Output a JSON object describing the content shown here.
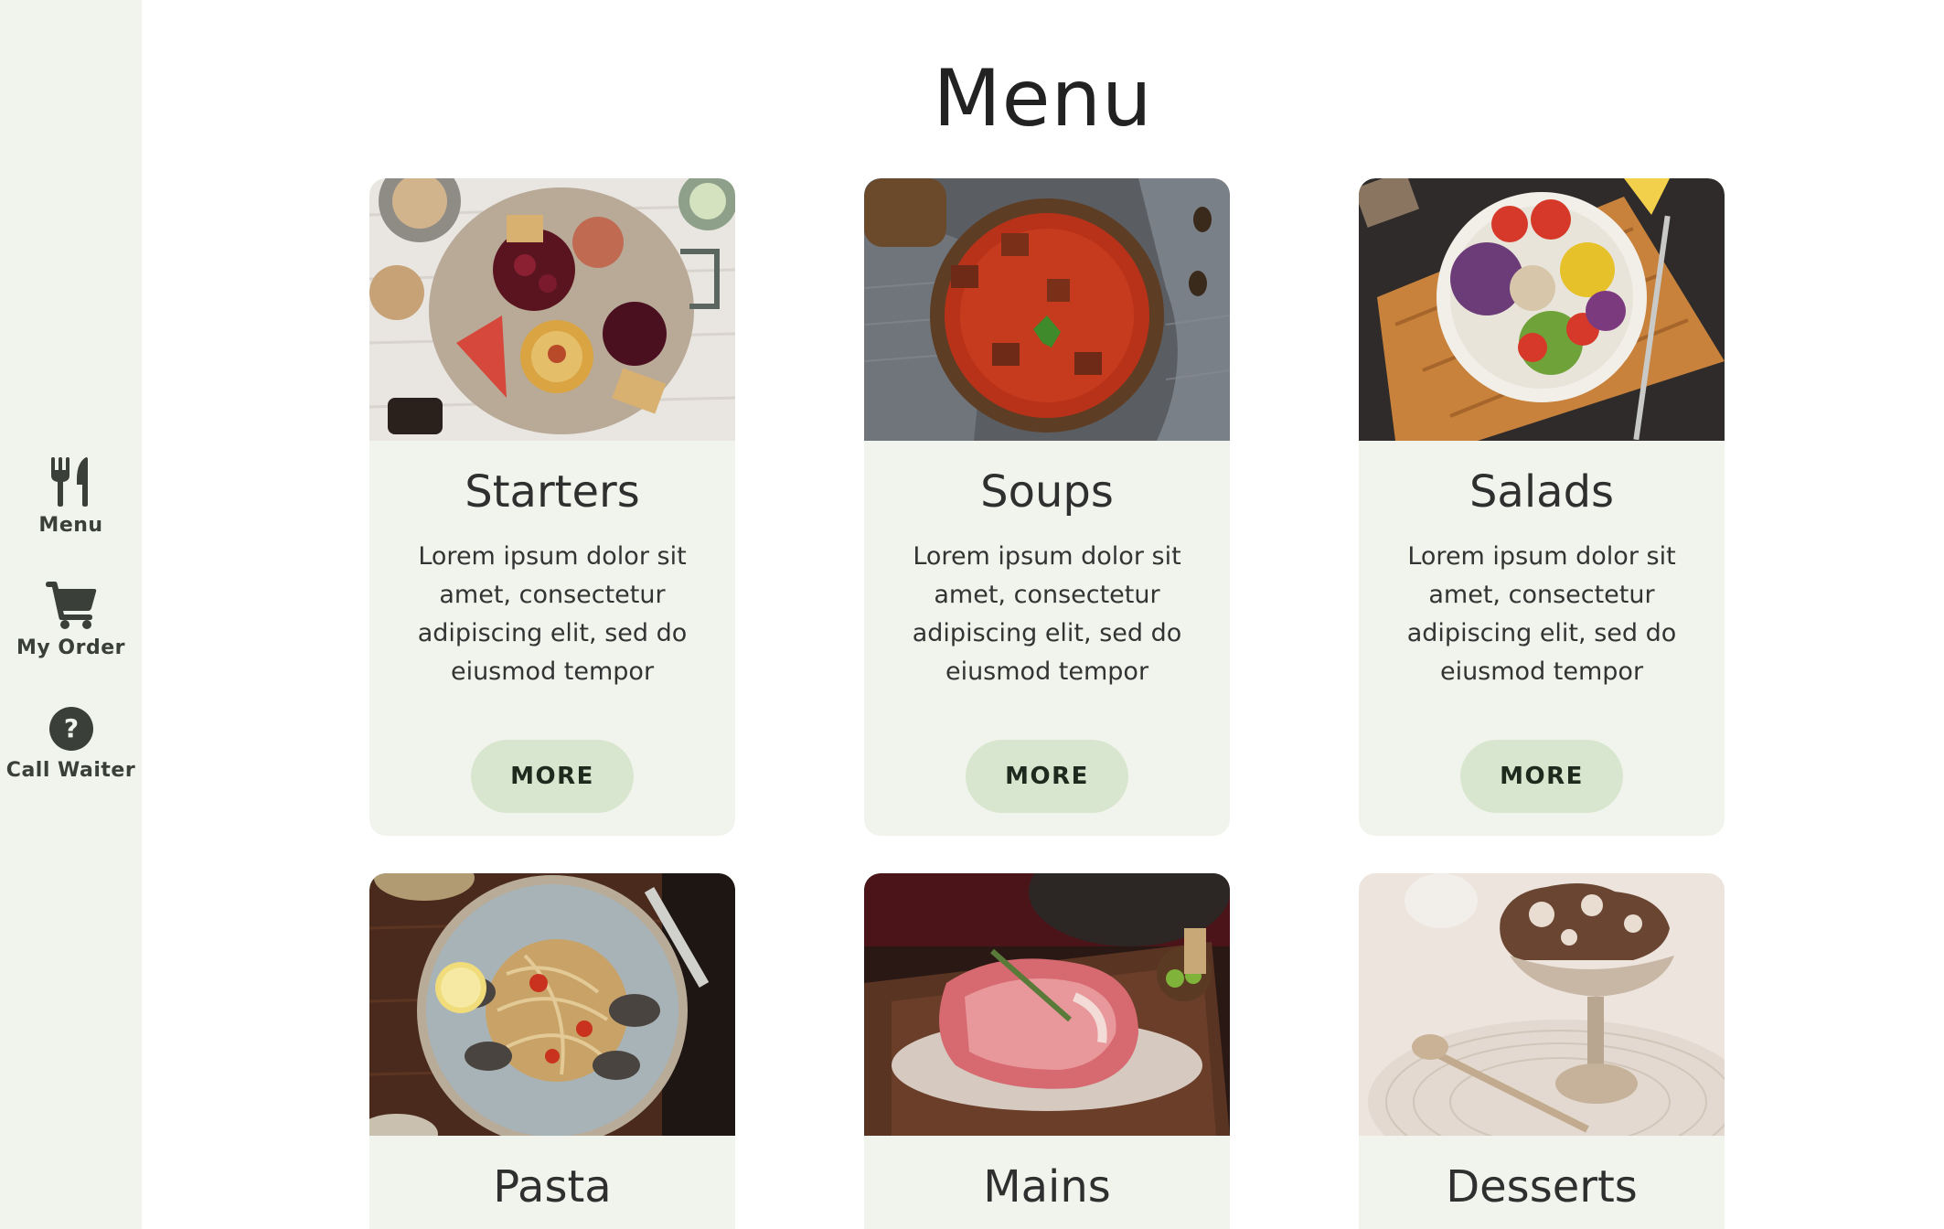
{
  "sidebar": {
    "items": [
      {
        "label": "Menu",
        "icon": "fork-knife-icon"
      },
      {
        "label": "My Order",
        "icon": "cart-icon"
      },
      {
        "label": "Call Waiter",
        "icon": "question-icon"
      }
    ]
  },
  "page": {
    "title": "Menu"
  },
  "colors": {
    "sidebar_bg": "#f1f4ec",
    "card_bg": "#f1f4ec",
    "button_bg": "#d9e6cf",
    "icon": "#3a3f3a"
  },
  "cards": [
    {
      "title": "Starters",
      "description": "Lorem ipsum dolor sit amet, consectetur adipiscing elit, sed do eiusmod tempor",
      "button": "MORE"
    },
    {
      "title": "Soups",
      "description": "Lorem ipsum dolor sit amet, consectetur adipiscing elit, sed do eiusmod tempor",
      "button": "MORE"
    },
    {
      "title": "Salads",
      "description": "Lorem ipsum dolor sit amet, consectetur adipiscing elit, sed do eiusmod tempor",
      "button": "MORE"
    },
    {
      "title": "Pasta"
    },
    {
      "title": "Mains"
    },
    {
      "title": "Desserts"
    }
  ]
}
